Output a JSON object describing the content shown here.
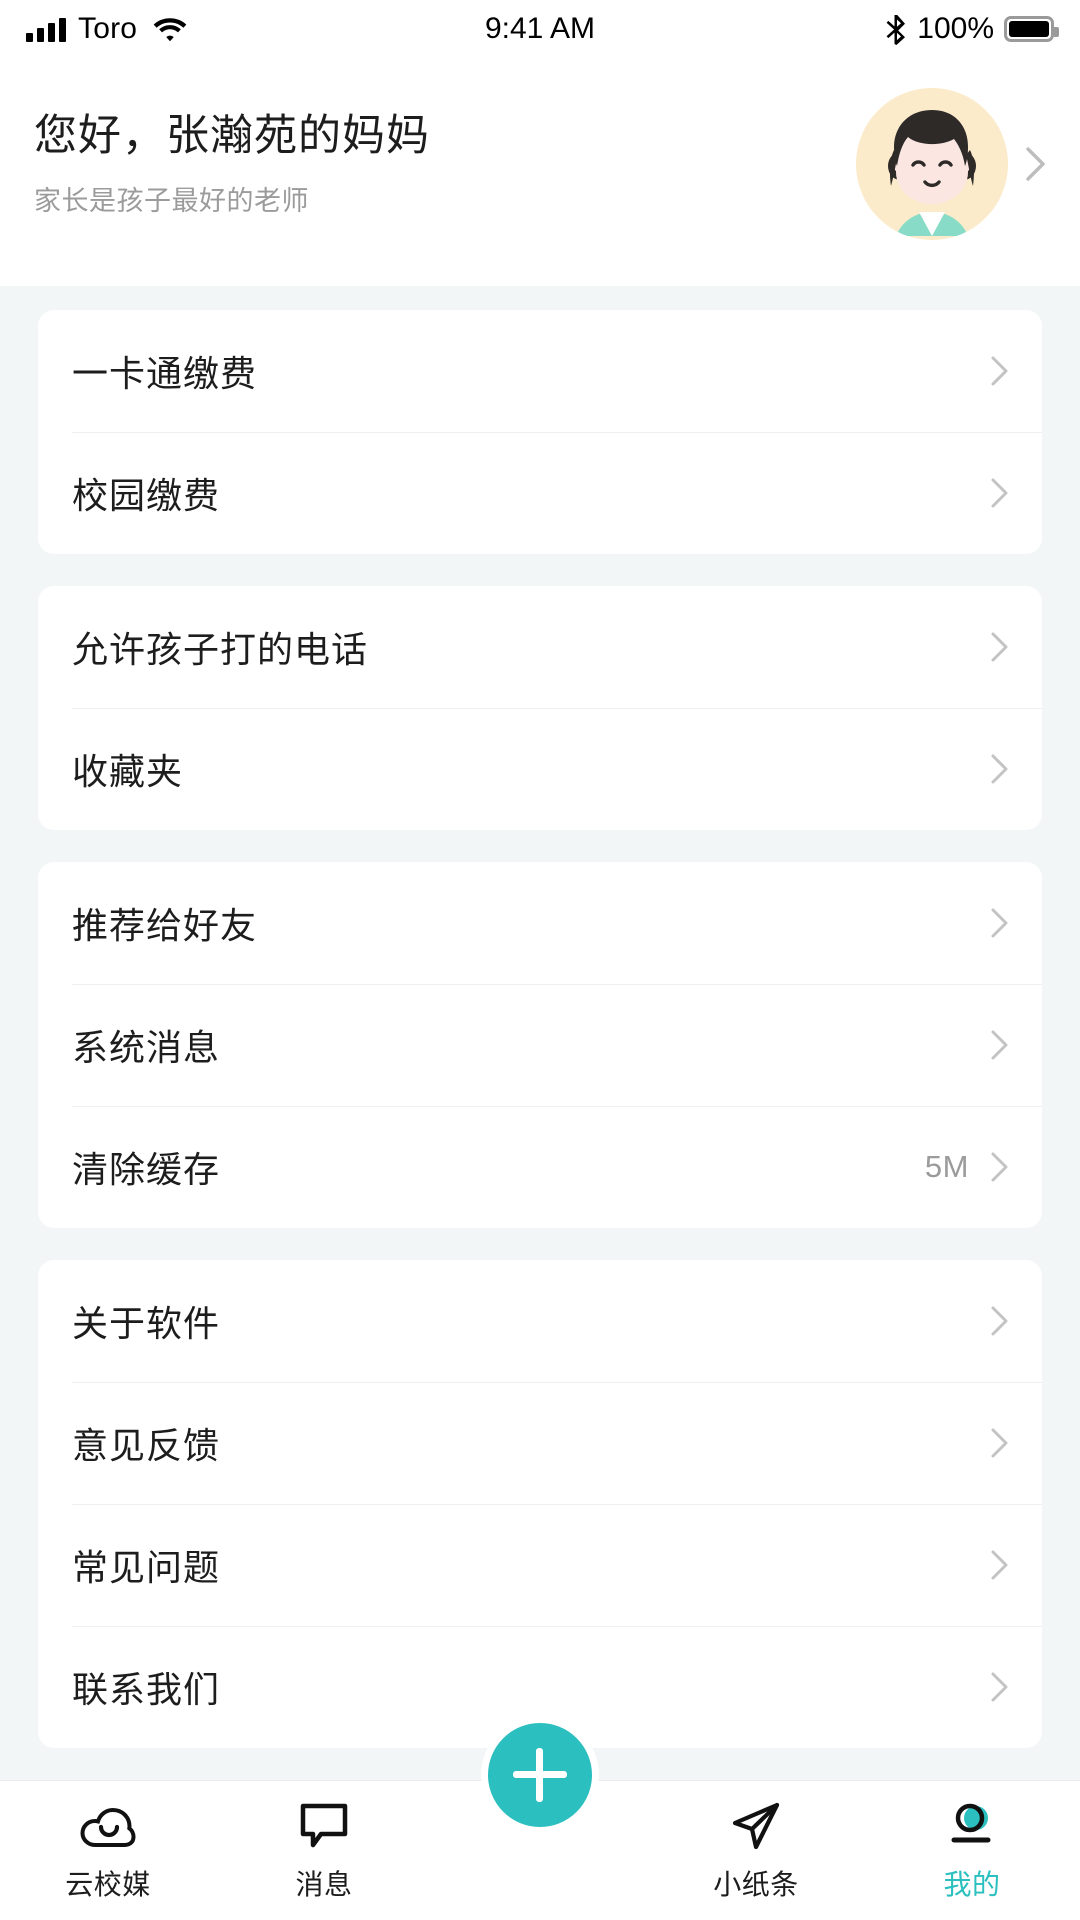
{
  "statusbar": {
    "carrier": "Toro",
    "time": "9:41 AM",
    "battery_text": "100%",
    "icons": [
      "signal-icon",
      "wifi-icon",
      "bluetooth-icon",
      "battery-icon"
    ]
  },
  "header": {
    "greeting": "您好，张瀚苑的妈妈",
    "subtitle": "家长是孩子最好的老师",
    "avatar_bg": "#FCEBCB",
    "avatar_hair": "#2E2A28",
    "avatar_face": "#FBE6E2",
    "avatar_shirt": "#88DBC6"
  },
  "theme": {
    "accent": "#2BBFBF",
    "page_bg": "#F2F6F7",
    "card_bg": "#FFFFFF",
    "text": "#1D1D1D",
    "muted": "#9B9B9B"
  },
  "groups": [
    {
      "items": [
        {
          "label": "一卡通缴费",
          "value": ""
        },
        {
          "label": "校园缴费",
          "value": ""
        }
      ]
    },
    {
      "items": [
        {
          "label": "允许孩子打的电话",
          "value": ""
        },
        {
          "label": "收藏夹",
          "value": ""
        }
      ]
    },
    {
      "items": [
        {
          "label": "推荐给好友",
          "value": ""
        },
        {
          "label": "系统消息",
          "value": ""
        },
        {
          "label": "清除缓存",
          "value": "5M"
        }
      ]
    },
    {
      "items": [
        {
          "label": "关于软件",
          "value": ""
        },
        {
          "label": "意见反馈",
          "value": ""
        },
        {
          "label": "常见问题",
          "value": ""
        },
        {
          "label": "联系我们",
          "value": ""
        }
      ]
    }
  ],
  "tabbar": {
    "fab_label": "add-button",
    "tabs": [
      {
        "label": "云校媒",
        "icon": "cloud-smile-icon",
        "active": false
      },
      {
        "label": "消息",
        "icon": "speech-bubble-icon",
        "active": false
      },
      {
        "label": "小纸条",
        "icon": "paper-plane-icon",
        "active": false
      },
      {
        "label": "我的",
        "icon": "profile-icon",
        "active": true
      }
    ]
  }
}
